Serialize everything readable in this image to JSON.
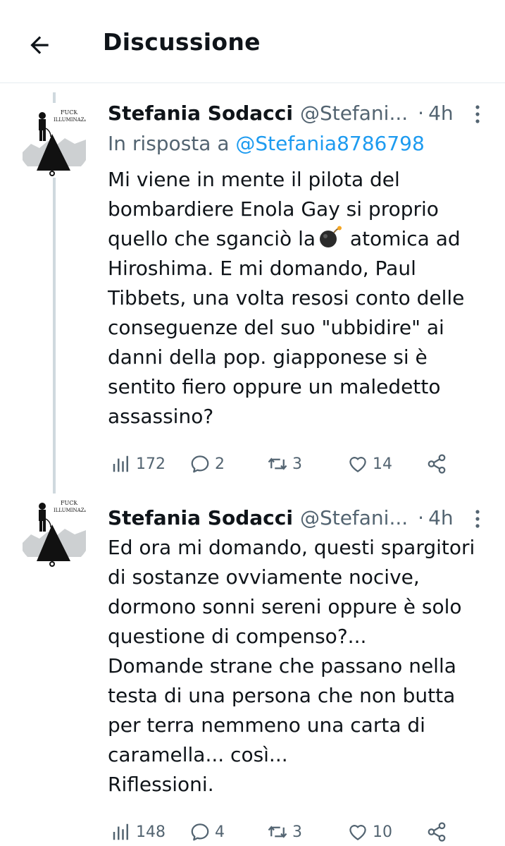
{
  "header": {
    "title": "Discussione"
  },
  "tweets": [
    {
      "author_name": "Stefania Sodacci",
      "author_handle": "@Stefani...",
      "time": "4h",
      "reply_prefix": "In risposta a",
      "reply_to": "@Stefania8786798",
      "text_before_emoji": "Mi viene in mente il pilota del\nbombardiere Enola Gay si proprio\nquello che sganciò la",
      "emoji": "bomb-emoji",
      "text_after_emoji": " atomica ad\nHiroshima. E mi domando, Paul\nTibbets, una volta resosi conto delle\nconseguenze del suo \"ubbidire\" ai\ndanni della pop. giapponese si è\nsentito fiero oppure un maledetto\nassassino?",
      "avatar_text_line1": "FUCK",
      "avatar_text_line2": "ILLUMINAZIS",
      "stats": {
        "views": "172",
        "replies": "2",
        "retweets": "3",
        "likes": "14"
      }
    },
    {
      "author_name": "Stefania Sodacci",
      "author_handle": "@Stefani...",
      "time": "4h",
      "text": "Ed ora mi domando, questi spargitori\ndi sostanze ovviamente nocive,\ndormono sonni sereni oppure è solo\nquestione di compenso?...\nDomande strane che passano nella\ntesta di una persona che non butta\nper terra nemmeno una carta di\ncaramella... così...\nRiflessioni.",
      "avatar_text_line1": "FUCK",
      "avatar_text_line2": "ILLUMINAZIS",
      "stats": {
        "views": "148",
        "replies": "4",
        "retweets": "3",
        "likes": "10"
      }
    }
  ],
  "colors": {
    "text": "#0f1419",
    "secondary": "#536471",
    "link": "#1d9bf0",
    "divider": "#e6ecf0",
    "thread_line": "#cfd9de"
  }
}
